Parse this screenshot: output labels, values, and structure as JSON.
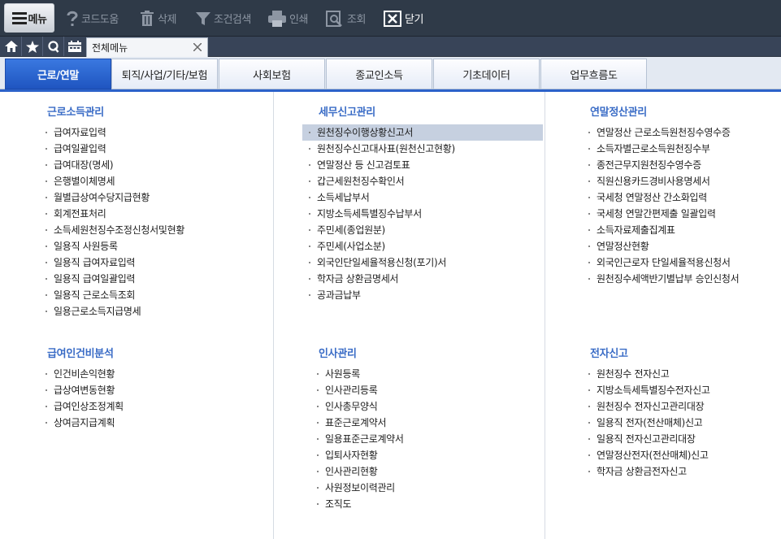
{
  "toolbar": {
    "menu_label": "메뉴",
    "buttons": [
      {
        "label": "코드도움",
        "icon": "help-icon"
      },
      {
        "label": "삭제",
        "icon": "trash-icon"
      },
      {
        "label": "조건검색",
        "icon": "filter-icon"
      },
      {
        "label": "인쇄",
        "icon": "printer-icon"
      },
      {
        "label": "조회",
        "icon": "search-icon"
      },
      {
        "label": "닫기",
        "icon": "close-box-icon"
      }
    ]
  },
  "tabstrip": {
    "icons": [
      "home-icon",
      "star-icon",
      "search-q-icon",
      "calendar-icon"
    ],
    "open_tab": "전체메뉴"
  },
  "categories": [
    {
      "label": "근로/연말",
      "active": true
    },
    {
      "label": "퇴직/사업/기타/보험",
      "active": false
    },
    {
      "label": "사회보험",
      "active": false
    },
    {
      "label": "종교인소득",
      "active": false
    },
    {
      "label": "기초데이터",
      "active": false
    },
    {
      "label": "업무흐름도",
      "active": false
    }
  ],
  "sections": [
    {
      "title": "근로소득관리",
      "items": [
        "급여자료입력",
        "급여일괄입력",
        "급여대장(명세)",
        "은행별이체명세",
        "월별급상여수당지급현황",
        "회계전표처리",
        "소득세원천징수조정신청서및현황",
        "일용직 사원등록",
        "일용직 급여자료입력",
        "일용직 급여일괄입력",
        "일용직 근로소득조회",
        "일용근로소득지급명세"
      ]
    },
    {
      "title": "세무신고관리",
      "items": [
        "원천징수이행상황신고서",
        "원천징수신고대사표(원천신고현황)",
        "연말정산 등 신고검토표",
        "갑근세원천징수확인서",
        "소득세납부서",
        "지방소득세특별징수납부서",
        "주민세(종업원분)",
        "주민세(사업소분)",
        "외국인단일세율적용신청(포기)서",
        "학자금 상환금명세서",
        "공과금납부"
      ]
    },
    {
      "title": "연말정산관리",
      "items": [
        "연말정산 근로소득원천징수영수증",
        "소득자별근로소득원천징수부",
        "종전근무지원천징수영수증",
        "직원신용카드경비사용명세서",
        "국세청 연말정산 간소화입력",
        "국세청 연말간편제출 일괄입력",
        "소득자료제출집계표",
        "연말정산현황",
        "외국인근로자 단일세율적용신청서",
        "원천징수세액반기별납부 승인신청서"
      ]
    },
    {
      "title": "급여인건비분석",
      "items": [
        "인건비손익현황",
        "급상여변동현황",
        "급여인상조정계획",
        "상여금지급계획"
      ]
    },
    {
      "title": "인사관리",
      "items": [
        "사원등록",
        "인사관리등록",
        "인사총무양식",
        "표준근로계약서",
        "일용표준근로계약서",
        "입퇴사자현황",
        "인사관리현황",
        "사원정보이력관리",
        "조직도"
      ]
    },
    {
      "title": "전자신고",
      "items": [
        "원천징수 전자신고",
        "지방소득세특별징수전자신고",
        "원천징수 전자신고관리대장",
        "일용직 전자(전산매체)신고",
        "일용직 전자신고관리대장",
        "연말정산전자(전산매체)신고",
        "학자금 상환금전자신고"
      ]
    }
  ],
  "highlighted_item": "원천징수이행상황신고서"
}
